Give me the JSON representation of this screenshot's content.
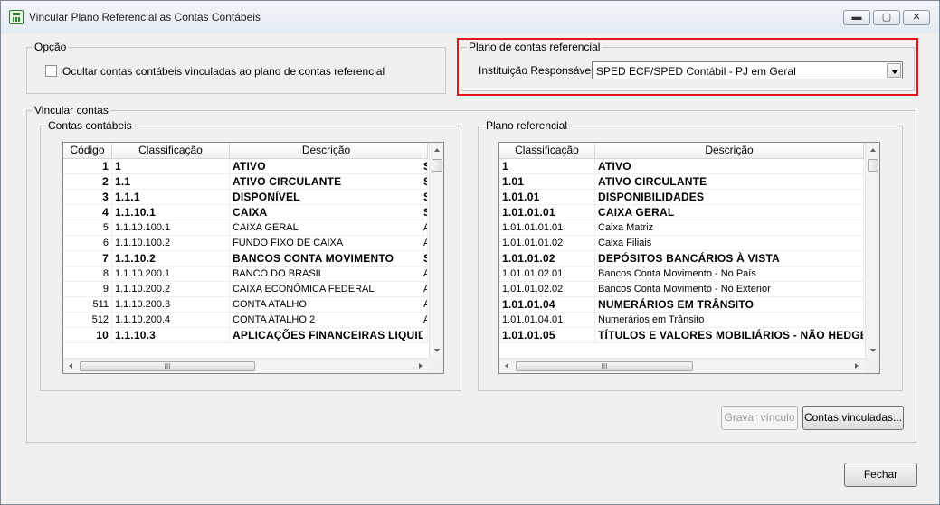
{
  "window": {
    "title": "Vincular Plano Referencial as Contas Contábeis",
    "minimize_glyph": "▬",
    "maximize_glyph": "▢",
    "close_glyph": "✕",
    "icon": "calculator-icon"
  },
  "opcao": {
    "legend": "Opção",
    "checkbox_label": "Ocultar contas contábeis vinculadas ao plano de contas referencial",
    "checked": false
  },
  "plano_referencial_group": {
    "legend": "Plano de contas referencial",
    "instituicao_label": "Instituição Responsável:",
    "instituicao_value": "SPED ECF/SPED Contábil - PJ em Geral"
  },
  "vincular": {
    "legend": "Vincular contas",
    "contas": {
      "legend": "Contas contábeis",
      "columns": [
        "Código",
        "Classificação",
        "Descrição"
      ],
      "rows": [
        {
          "codigo": "1",
          "classificacao": "1",
          "descricao": "ATIVO",
          "extra": "S",
          "bold": true
        },
        {
          "codigo": "2",
          "classificacao": "1.1",
          "descricao": "ATIVO CIRCULANTE",
          "extra": "S",
          "bold": true
        },
        {
          "codigo": "3",
          "classificacao": "1.1.1",
          "descricao": "DISPONÍVEL",
          "extra": "S",
          "bold": true
        },
        {
          "codigo": "4",
          "classificacao": "1.1.10.1",
          "descricao": "CAIXA",
          "extra": "S",
          "bold": true
        },
        {
          "codigo": "5",
          "classificacao": "1.1.10.100.1",
          "descricao": "CAIXA GERAL",
          "extra": "A",
          "bold": false
        },
        {
          "codigo": "6",
          "classificacao": "1.1.10.100.2",
          "descricao": "FUNDO FIXO DE CAIXA",
          "extra": "A",
          "bold": false
        },
        {
          "codigo": "7",
          "classificacao": "1.1.10.2",
          "descricao": "BANCOS CONTA MOVIMENTO",
          "extra": "S",
          "bold": true
        },
        {
          "codigo": "8",
          "classificacao": "1.1.10.200.1",
          "descricao": "BANCO DO BRASIL",
          "extra": "A",
          "bold": false
        },
        {
          "codigo": "9",
          "classificacao": "1.1.10.200.2",
          "descricao": "CAIXA ECONÔMICA FEDERAL",
          "extra": "A",
          "bold": false
        },
        {
          "codigo": "511",
          "classificacao": "1.1.10.200.3",
          "descricao": "CONTA ATALHO",
          "extra": "A",
          "bold": false
        },
        {
          "codigo": "512",
          "classificacao": "1.1.10.200.4",
          "descricao": "CONTA ATALHO 2",
          "extra": "A",
          "bold": false
        },
        {
          "codigo": "10",
          "classificacao": "1.1.10.3",
          "descricao": "APLICAÇÕES FINANCEIRAS LIQUIDEZ",
          "extra": "",
          "bold": true
        }
      ]
    },
    "plano": {
      "legend": "Plano referencial",
      "columns": [
        "Classificação",
        "Descrição"
      ],
      "rows": [
        {
          "classificacao": "1",
          "descricao": "ATIVO",
          "bold": true
        },
        {
          "classificacao": "1.01",
          "descricao": "ATIVO CIRCULANTE",
          "bold": true
        },
        {
          "classificacao": "1.01.01",
          "descricao": "DISPONIBILIDADES",
          "bold": true
        },
        {
          "classificacao": "1.01.01.01",
          "descricao": "CAIXA GERAL",
          "bold": true
        },
        {
          "classificacao": "1.01.01.01.01",
          "descricao": "Caixa Matriz",
          "bold": false
        },
        {
          "classificacao": "1.01.01.01.02",
          "descricao": "Caixa Filiais",
          "bold": false
        },
        {
          "classificacao": "1.01.01.02",
          "descricao": "DEPÓSITOS BANCÁRIOS À VISTA",
          "bold": true
        },
        {
          "classificacao": "1.01.01.02.01",
          "descricao": "Bancos Conta Movimento - No País",
          "bold": false
        },
        {
          "classificacao": "1.01.01.02.02",
          "descricao": "Bancos Conta Movimento - No Exterior",
          "bold": false
        },
        {
          "classificacao": "1.01.01.04",
          "descricao": "NUMERÁRIOS EM TRÂNSITO",
          "bold": true
        },
        {
          "classificacao": "1.01.01.04.01",
          "descricao": "Numerários em Trânsito",
          "bold": false
        },
        {
          "classificacao": "1.01.01.05",
          "descricao": "TÍTULOS E VALORES MOBILIÁRIOS - NÃO HEDGE",
          "bold": true
        }
      ]
    },
    "scroll_grip": "III",
    "gravar_label": "Gravar vínculo",
    "contas_vinculadas_label": "Contas vinculadas..."
  },
  "fechar_label": "Fechar",
  "colors": {
    "highlight": "#e0161c",
    "background": "#f0f0f0"
  }
}
